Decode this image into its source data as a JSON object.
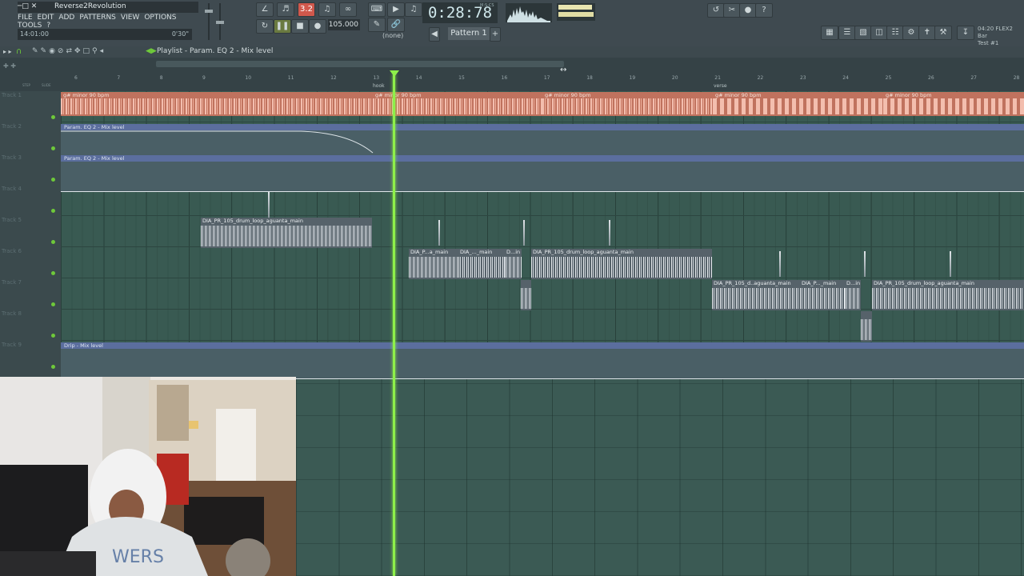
{
  "window": {
    "title": "Reverse2Revolution",
    "hint": "14:01:00",
    "hint_right": "0'30\""
  },
  "menu": [
    "FILE",
    "EDIT",
    "ADD",
    "PATTERNS",
    "VIEW",
    "OPTIONS",
    "TOOLS",
    "?"
  ],
  "transport": {
    "time": "0:28:78",
    "time_unit": "M:S:CS",
    "tempo": "105.000",
    "rec_badge": "3.2",
    "pattern": "Pattern 1",
    "none_label": "(none)"
  },
  "info": {
    "line1": "04:20  FLEX2 Bar",
    "line2": "Test #1"
  },
  "playlist": {
    "title": "Playlist - Param. EQ 2 - Mix level",
    "mode1": "STEP",
    "mode2": "SLIDE"
  },
  "ruler": {
    "bars": [
      "6",
      "7",
      "8",
      "9",
      "10",
      "11",
      "12",
      "13",
      "14",
      "15",
      "16",
      "17",
      "18",
      "19",
      "20",
      "21",
      "22",
      "23",
      "24",
      "25",
      "26",
      "27",
      "28"
    ],
    "markers": [
      "hook",
      "verse"
    ]
  },
  "tracks": [
    "Track 1",
    "Track 2",
    "Track 3",
    "Track 4",
    "Track 5",
    "Track 6",
    "Track 7",
    "Track 8",
    "Track 9"
  ],
  "clips": {
    "audio_label": "g# minor 90 bpm",
    "auto_eq": "Param. EQ 2 - Mix level",
    "auto_drip": "Drip - Mix level",
    "drum_main": "DIA_PR_105_drum_loop_aguanta_main",
    "drum_short_a": "DIA_P...a_main",
    "drum_short_b": "DIA_..._main",
    "drum_short_c": "D...in",
    "drum_t7_a": "DIA_PR_105_d..aguanta_main",
    "drum_t7_b": "DIA_P..._main",
    "drum_t7_c": "D...in"
  },
  "colors": {
    "playhead": "#8ef04a",
    "audio_clip": "#c0725e",
    "automation": "#5b6e9e",
    "grid": "#395a52"
  }
}
